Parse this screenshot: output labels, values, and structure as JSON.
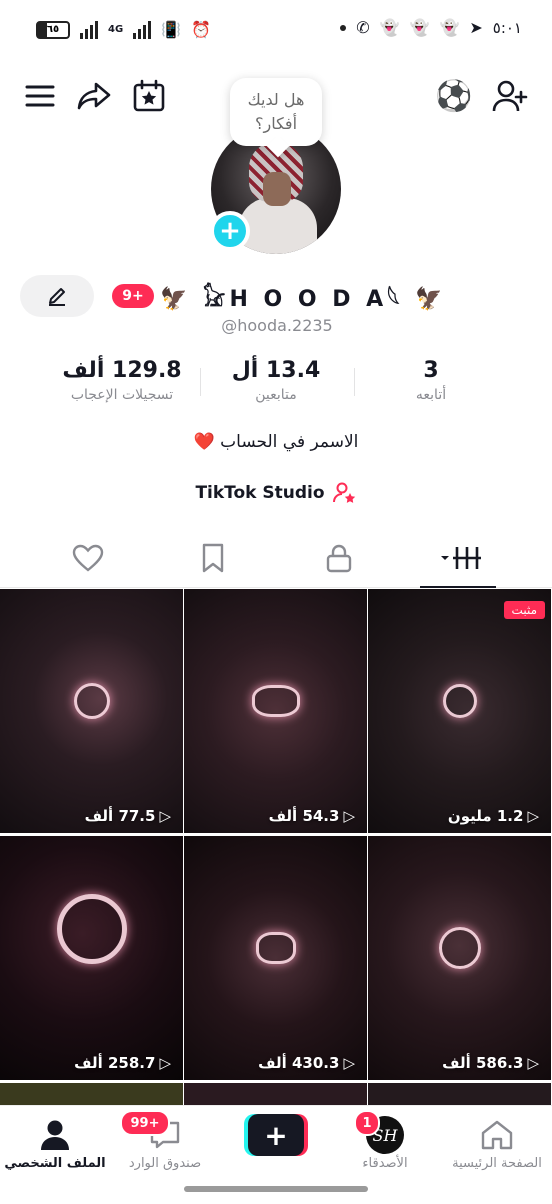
{
  "status_bar": {
    "time": "٥:٠١",
    "battery": "٦٥",
    "network": "4G"
  },
  "bubble": {
    "text": "هل لديك أفكار؟"
  },
  "profile": {
    "display_name": "H O O D A",
    "badge": "9+",
    "username": "@hooda.2235",
    "bio": "الاسمر في الحساب ❤️",
    "studio": "TikTok Studio"
  },
  "stats": {
    "likes": {
      "value": "129.8 ألف",
      "label": "تسجيلات الإعجاب"
    },
    "followers": {
      "value": "13.4 أل",
      "label": "متابعين"
    },
    "following": {
      "value": "3",
      "label": "أتابعه"
    }
  },
  "videos": [
    {
      "views": "77.5 ألف",
      "pinned": ""
    },
    {
      "views": "54.3 ألف",
      "pinned": ""
    },
    {
      "views": "1.2 مليون",
      "pinned": "مثبت"
    },
    {
      "views": "258.7 ألف",
      "pinned": ""
    },
    {
      "views": "430.3 ألف",
      "pinned": ""
    },
    {
      "views": "586.3 ألف",
      "pinned": ""
    }
  ],
  "nav": {
    "profile": "الملف الشخصي",
    "inbox": "صندوق الوارد",
    "inbox_badge": "99+",
    "friends": "الأصدقاء",
    "friends_badge": "1",
    "home": "الصفحة الرئيسية"
  },
  "colors": {
    "accent": "#fe2c55",
    "cyan": "#20d5ec"
  }
}
